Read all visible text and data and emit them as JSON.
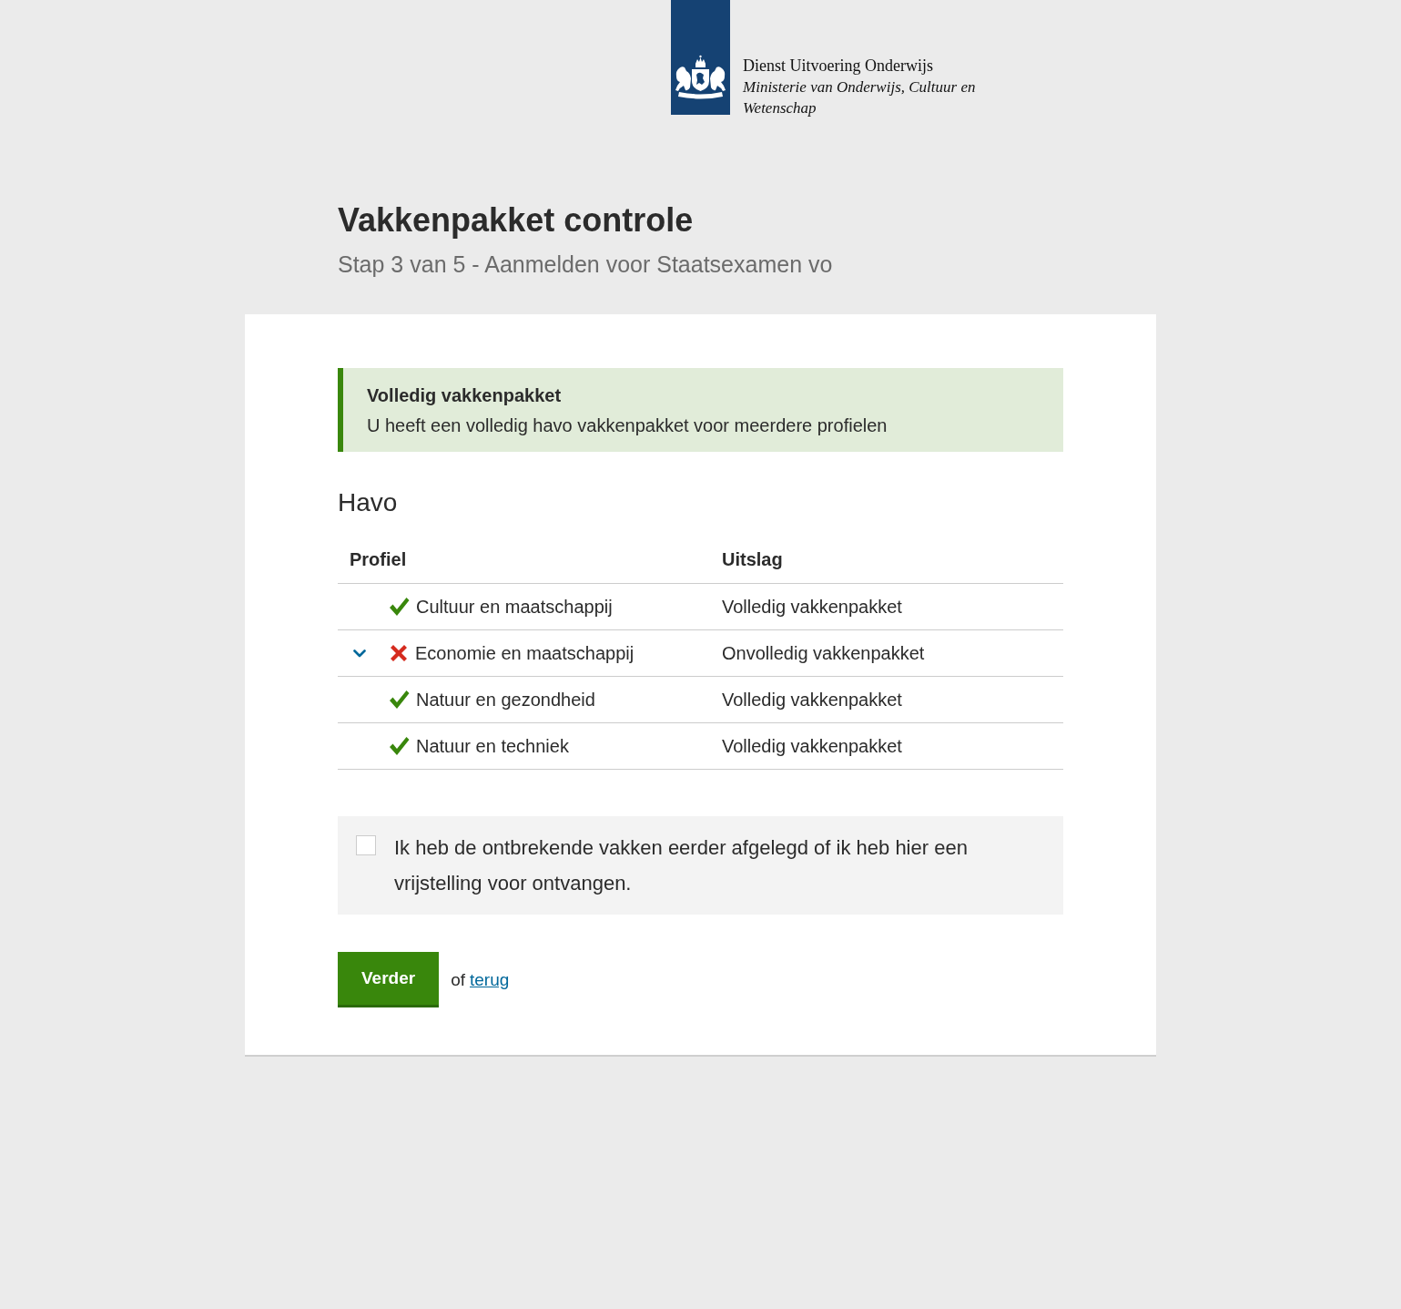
{
  "header": {
    "organization": "Dienst Uitvoering Onderwijs",
    "ministry": "Ministerie van Onderwijs, Cultuur en Wetenschap"
  },
  "page": {
    "title": "Vakkenpakket controle",
    "subtitle": "Stap 3 van 5 - Aanmelden voor Staatsexamen vo"
  },
  "alert": {
    "kind": "success",
    "title": "Volledig vakkenpakket",
    "message": "U heeft een volledig havo vakkenpakket voor meerdere profielen"
  },
  "section": {
    "heading": "Havo"
  },
  "table": {
    "columns": [
      "Profiel",
      "Uitslag"
    ],
    "rows": [
      {
        "kind": "complete",
        "expandable": false,
        "profile": "Cultuur en maatschappij",
        "result": "Volledig vakkenpakket"
      },
      {
        "kind": "incomplete",
        "expandable": true,
        "profile": "Economie en maatschappij",
        "result": "Onvolledig vakkenpakket"
      },
      {
        "kind": "complete",
        "expandable": false,
        "profile": "Natuur en gezondheid",
        "result": "Volledig vakkenpakket"
      },
      {
        "kind": "complete",
        "expandable": false,
        "profile": "Natuur en techniek",
        "result": "Volledig vakkenpakket"
      }
    ]
  },
  "confirmation": {
    "checked": false,
    "label": "Ik heb de ontbrekende vakken eerder afgelegd of ik heb hier een vrijstelling voor ontvangen."
  },
  "actions": {
    "primary": "Verder",
    "separator": "of",
    "link": "terug"
  }
}
